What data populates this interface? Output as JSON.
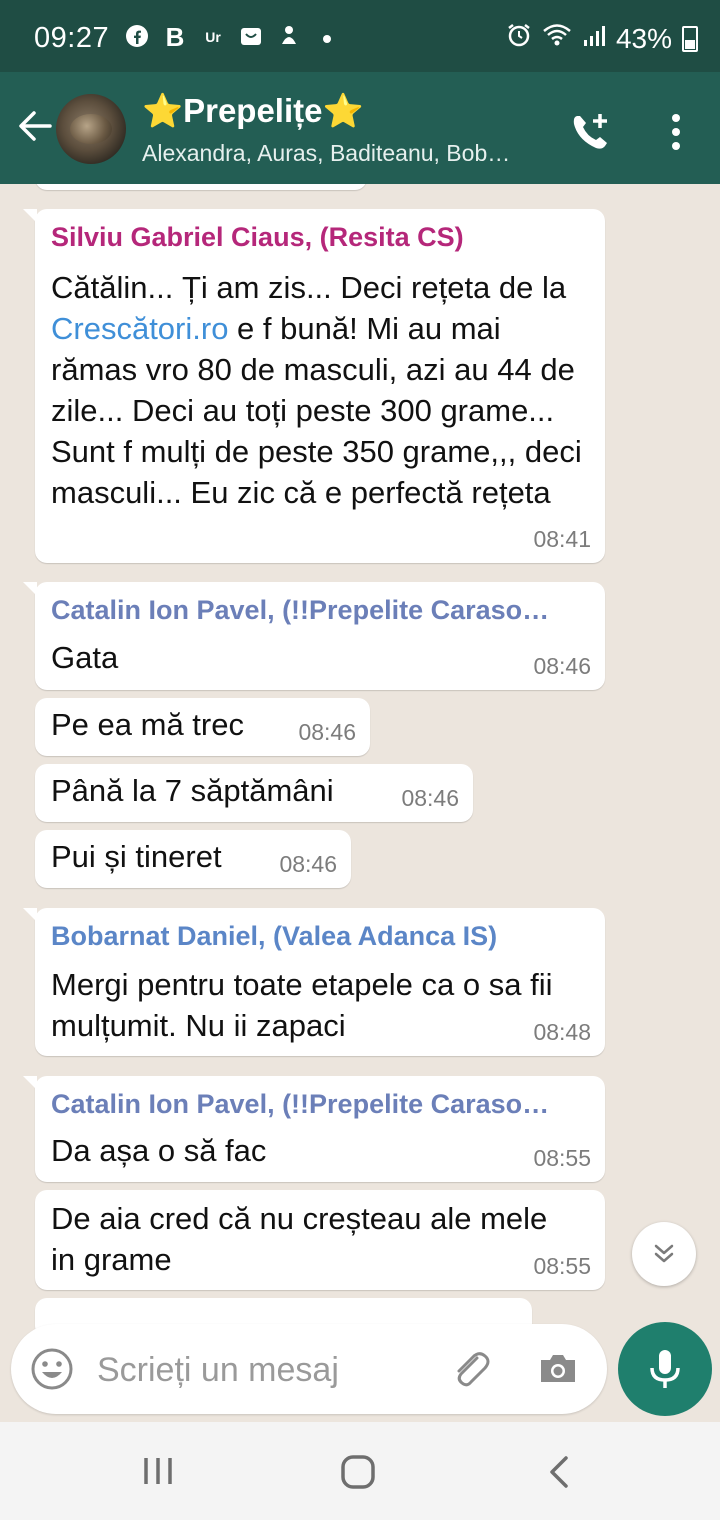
{
  "status_bar": {
    "time": "09:27",
    "app_icons": [
      "facebook-icon",
      "b-icon",
      "un-icon",
      "briefcase-icon",
      "hand-icon",
      "dot-icon"
    ],
    "battery": "43%",
    "icons": [
      "alarm-icon",
      "wifi-icon",
      "signal-icon",
      "battery-icon"
    ]
  },
  "header": {
    "title_prefix": "⭐",
    "title": "Prepelițe",
    "title_suffix": "⭐",
    "members": "Alexandra, Auras, Baditeanu, Bob…"
  },
  "messages": [
    {
      "sender": "Silviu Gabriel Ciaus, (Resita CS)",
      "sender_color": "#b5277a",
      "text_parts": [
        "Cătălin... Ți am zis... Deci rețeta de la ",
        "Crescători.ro",
        " e f bună! Mi au mai rămas vro 80 de masculi, azi au 44 de zile... Deci au toți peste 300 grame... Sunt f mulți de peste 350 grame,,, deci masculi... Eu zic că e perfectă rețeta"
      ],
      "time": "08:41"
    },
    {
      "sender": "Catalin Ion Pavel, (!!Prepelite Caraso…",
      "sender_color": "#6b7fb8",
      "text": "Gata",
      "time": "08:46"
    },
    {
      "text": "Pe ea mă trec",
      "time": "08:46"
    },
    {
      "text": "Până la 7 săptămâni",
      "time": "08:46"
    },
    {
      "text": "Pui și tineret",
      "time": "08:46"
    },
    {
      "sender": "Bobarnat Daniel, (Valea Adanca IS)",
      "sender_color": "#5b86c7",
      "text": "Mergi pentru toate etapele ca o sa fii mulțumit. Nu ii zapaci",
      "time": "08:48"
    },
    {
      "sender": "Catalin Ion Pavel, (!!Prepelite Caraso…",
      "sender_color": "#6b7fb8",
      "text": "Da așa o să fac",
      "time": "08:55"
    },
    {
      "text": "De aia cred că nu creșteau ale mele in grame",
      "time": "08:55"
    }
  ],
  "input": {
    "placeholder": "Scrieți un mesaj"
  },
  "colors": {
    "status_bar": "#1f4d44",
    "header": "#235e54",
    "chat_bg": "#ece5dd",
    "mic_button": "#1f7f6d",
    "link": "#3f8fd8"
  }
}
